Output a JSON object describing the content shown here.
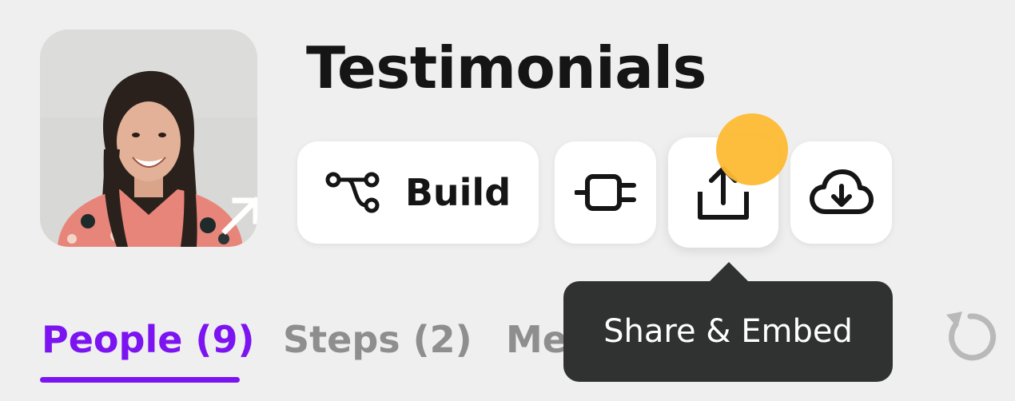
{
  "header": {
    "title": "Testimonials",
    "thumbnail": {
      "alt": "Smiling woman with long dark hair in floral top",
      "overlay_icon": "open-arrow-icon"
    }
  },
  "toolbar": {
    "build_label": "Build",
    "build_icon": "flow-branch-icon",
    "integrate_icon": "plug-icon",
    "share_icon": "share-upload-icon",
    "download_icon": "cloud-download-icon"
  },
  "tooltip": {
    "text": "Share & Embed"
  },
  "tabs": [
    {
      "label": "People (9)",
      "active": true
    },
    {
      "label": "Steps (2)",
      "active": false
    },
    {
      "label": "Metrics",
      "active": false
    }
  ],
  "actions": {
    "refresh_icon": "refresh-icon"
  },
  "colors": {
    "background": "#efefef",
    "accent": "#7b14f1",
    "tooltip_bg": "#303231",
    "cursor_highlight": "#fdb933",
    "inactive_tab": "#8e8e8e"
  }
}
